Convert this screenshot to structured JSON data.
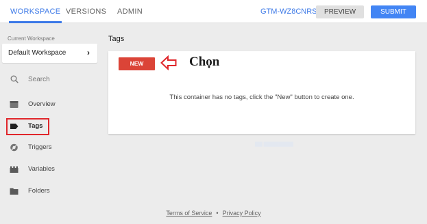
{
  "header": {
    "tabs": [
      "WORKSPACE",
      "VERSIONS",
      "ADMIN"
    ],
    "active_tab": "WORKSPACE",
    "container_id": "GTM-WZ8CNRS",
    "preview_label": "PREVIEW",
    "submit_label": "SUBMIT"
  },
  "sidebar": {
    "current_workspace_label": "Current Workspace",
    "workspace_name": "Default Workspace",
    "search_label": "Search",
    "items": [
      {
        "label": "Overview",
        "icon": "overview-icon"
      },
      {
        "label": "Tags",
        "icon": "tag-icon"
      },
      {
        "label": "Triggers",
        "icon": "trigger-icon"
      },
      {
        "label": "Variables",
        "icon": "variables-icon"
      },
      {
        "label": "Folders",
        "icon": "folder-icon"
      }
    ]
  },
  "main": {
    "title": "Tags",
    "new_button_label": "NEW",
    "annotation": "Chọn",
    "empty_message": "This container has no tags, click the \"New\" button to create one."
  },
  "footer": {
    "terms": "Terms of Service",
    "separator": "•",
    "privacy": "Privacy Policy"
  },
  "colors": {
    "accent": "#4285f4",
    "active_tab": "#3b78e7",
    "new_button": "#db4437",
    "highlight": "#e0262b"
  }
}
